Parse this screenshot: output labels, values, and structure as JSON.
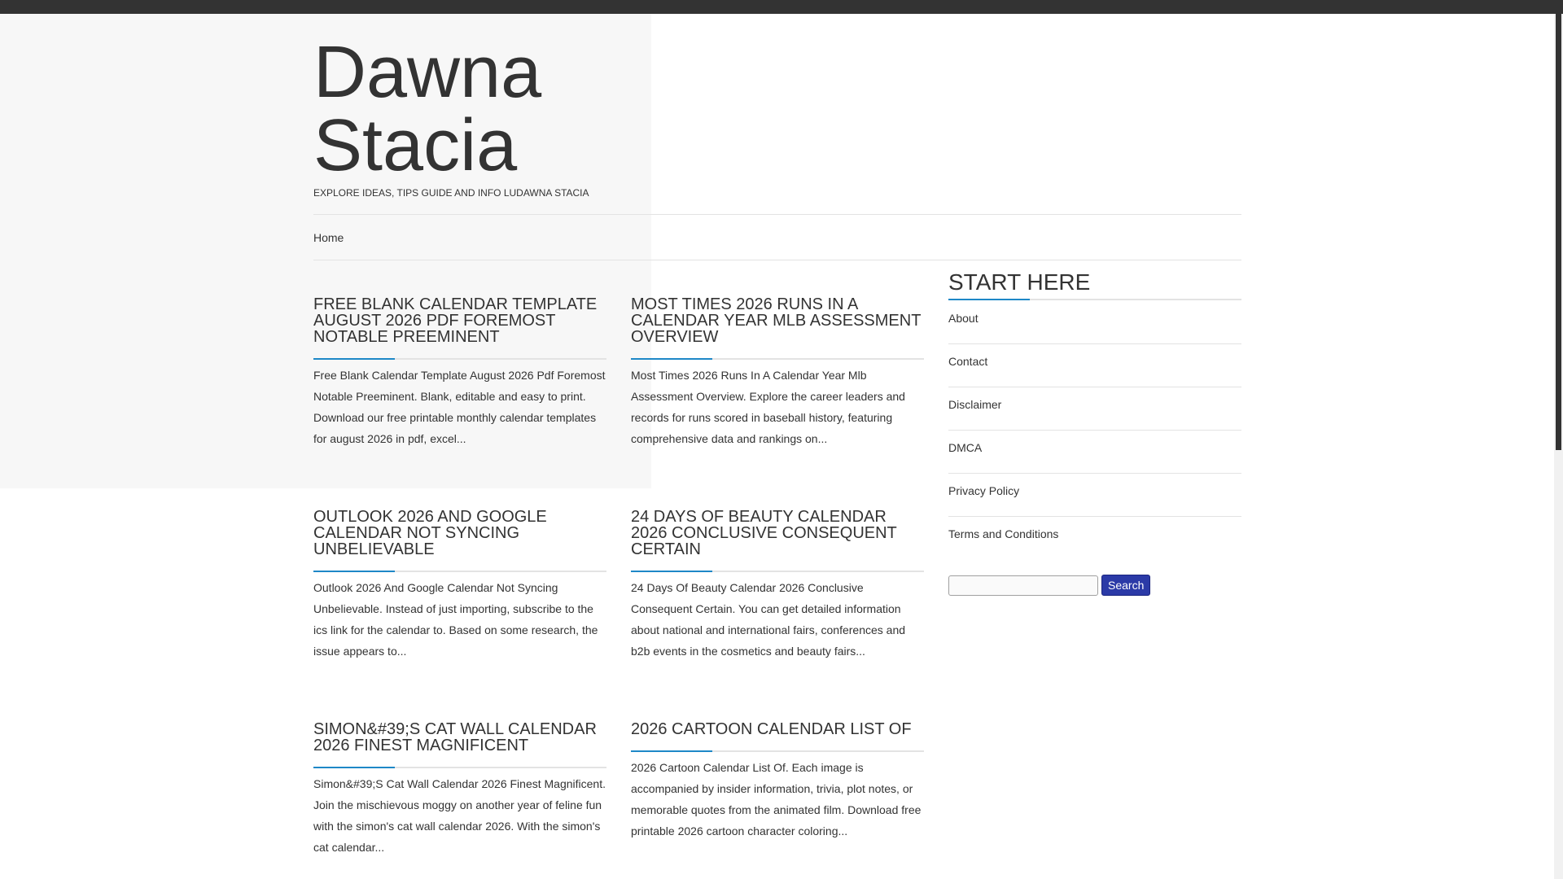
{
  "site": {
    "title_line1": "Dawna",
    "title_line2": "Stacia",
    "tagline": "EXPLORE IDEAS, TIPS GUIDE AND INFO LUDAWNA STACIA"
  },
  "nav": {
    "home": "Home"
  },
  "posts": [
    {
      "title": "FREE BLANK CALENDAR TEMPLATE AUGUST 2026 PDF FOREMOST NOTABLE PREEMINENT",
      "excerpt": "Free Blank Calendar Template August 2026 Pdf Foremost Notable Preeminent. Blank, editable and easy to print. Download our free printable monthly calendar templates for august 2026 in pdf, excel..."
    },
    {
      "title": "MOST TIMES 2026 RUNS IN A CALENDAR YEAR MLB ASSESSMENT OVERVIEW",
      "excerpt": "Most Times 2026 Runs In A Calendar Year Mlb Assessment Overview. Explore the career leaders and records for runs scored in baseball history, featuring comprehensive data and rankings on..."
    },
    {
      "title": "OUTLOOK 2026 AND GOOGLE CALENDAR NOT SYNCING UNBELIEVABLE",
      "excerpt": "Outlook 2026 And Google Calendar Not Syncing Unbelievable. Instead of just importing, subscribe to the ics link for the calendar to. Based on some research, the issue appears to..."
    },
    {
      "title": "24 DAYS OF BEAUTY CALENDAR 2026 CONCLUSIVE CONSEQUENT CERTAIN",
      "excerpt": "24 Days Of Beauty Calendar 2026 Conclusive Consequent Certain. You can get detailed information about national and international fairs, conferences and b2b events in the cosmetics and beauty fairs..."
    },
    {
      "title": "SIMON&#39;S CAT WALL CALENDAR 2026 FINEST MAGNIFICENT",
      "excerpt": "Simon&#39;S Cat Wall Calendar 2026 Finest Magnificent. Join the mischievous moggy on another year of feline fun with the simon's cat wall calendar 2026. With the simon's cat calendar..."
    },
    {
      "title": "2026 CARTOON CALENDAR LIST OF",
      "excerpt": "2026 Cartoon Calendar List Of. Each image is accompanied by insider information, trivia, plot notes, or memorable quotes from the animated film. Download free printable 2026 cartoon character coloring..."
    }
  ],
  "sidebar": {
    "heading": "START HERE",
    "links": [
      "About",
      "Contact",
      "Disclaimer",
      "DMCA",
      "Privacy Policy",
      "Terms and Conditions"
    ],
    "search_button": "Search",
    "search_value": ""
  }
}
